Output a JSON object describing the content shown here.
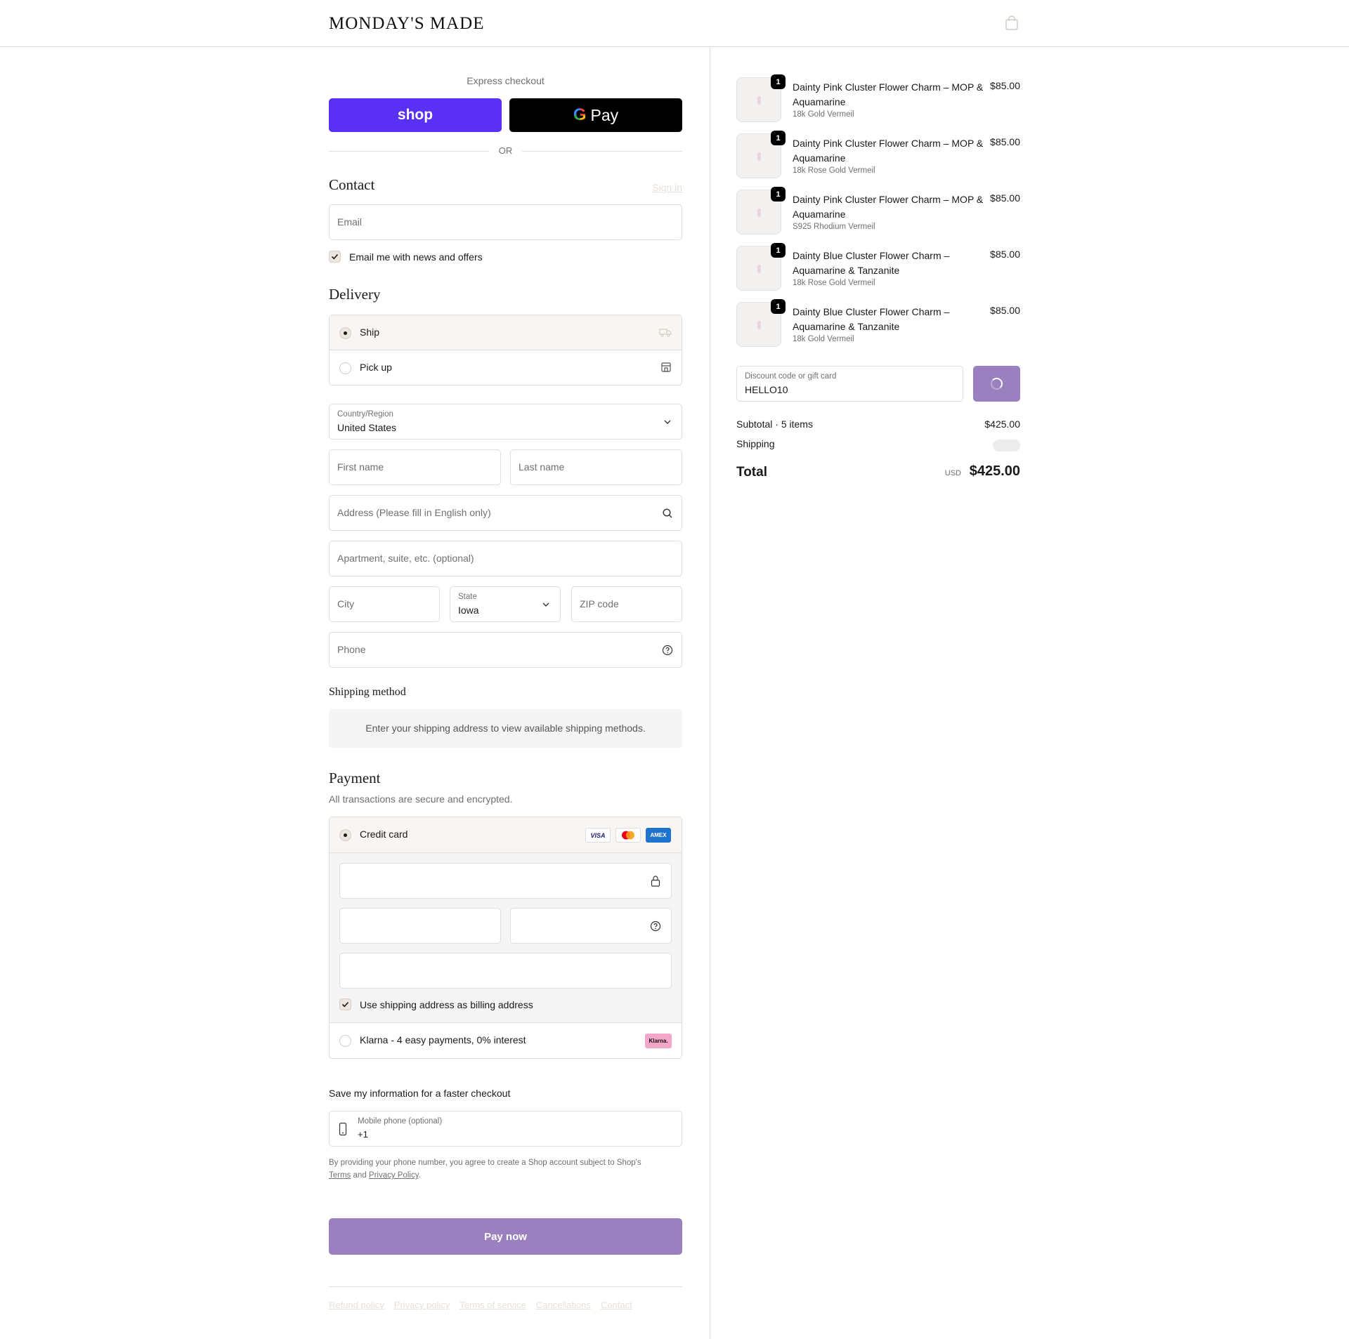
{
  "header": {
    "brand": "MONDAY'S MADE",
    "cart_icon": "shopping-bag-icon"
  },
  "express": {
    "label": "Express checkout",
    "shop_label": "shop",
    "gpay_g": "G",
    "gpay_label": "Pay",
    "or_label": "OR"
  },
  "contact": {
    "title": "Contact",
    "signin_label": "Sign in",
    "email_placeholder": "Email",
    "newsletter_label": "Email me with news and offers",
    "newsletter_checked": true
  },
  "delivery": {
    "title": "Delivery",
    "options": [
      {
        "label": "Ship",
        "icon": "truck-icon",
        "selected": true
      },
      {
        "label": "Pick up",
        "icon": "store-icon",
        "selected": false
      }
    ],
    "country_label": "Country/Region",
    "country_value": "United States",
    "first_name_placeholder": "First name",
    "last_name_placeholder": "Last name",
    "address_placeholder": "Address (Please fill in English only)",
    "apartment_placeholder": "Apartment, suite, etc. (optional)",
    "city_placeholder": "City",
    "state_label": "State",
    "state_value": "Iowa",
    "zip_placeholder": "ZIP code",
    "phone_placeholder": "Phone"
  },
  "shipping_method": {
    "title": "Shipping method",
    "info": "Enter your shipping address to view available shipping methods."
  },
  "payment": {
    "title": "Payment",
    "subtitle": "All transactions are secure and encrypted.",
    "credit_card_label": "Credit card",
    "card_brands": [
      "VISA",
      "MC",
      "AMEX"
    ],
    "billing_same_label": "Use shipping address as billing address",
    "klarna_label": "Klarna - 4 easy payments, 0% interest",
    "klarna_badge": "Klarna."
  },
  "save_info": {
    "title": "Save my information for a faster checkout",
    "mobile_label": "Mobile phone (optional)",
    "mobile_value": "+1",
    "legal_prefix": "By providing your phone number, you agree to create a Shop account subject to Shop's",
    "terms_link": "Terms",
    "and_text": "and",
    "privacy_link": "Privacy Policy",
    "period": "."
  },
  "pay_button": "Pay now",
  "footer_links": [
    "Refund policy",
    "Privacy policy",
    "Terms of service",
    "Cancellations",
    "Contact"
  ],
  "order": {
    "items": [
      {
        "qty": "1",
        "name": "Dainty Pink Cluster Flower Charm – MOP & Aquamarine",
        "variant": "18k Gold Vermeil",
        "price": "$85.00"
      },
      {
        "qty": "1",
        "name": "Dainty Pink Cluster Flower Charm – MOP & Aquamarine",
        "variant": "18k Rose Gold Vermeil",
        "price": "$85.00"
      },
      {
        "qty": "1",
        "name": "Dainty Pink Cluster Flower Charm – MOP & Aquamarine",
        "variant": "S925 Rhodium Vermeil",
        "price": "$85.00"
      },
      {
        "qty": "1",
        "name": "Dainty Blue Cluster Flower Charm – Aquamarine & Tanzanite",
        "variant": "18k Rose Gold Vermeil",
        "price": "$85.00"
      },
      {
        "qty": "1",
        "name": "Dainty Blue Cluster Flower Charm – Aquamarine & Tanzanite",
        "variant": "18k Gold Vermeil",
        "price": "$85.00"
      }
    ],
    "discount_label": "Discount code or gift card",
    "discount_value": "HELLO10",
    "subtotal_label": "Subtotal · 5 items",
    "subtotal_value": "$425.00",
    "shipping_label": "Shipping",
    "total_label": "Total",
    "currency": "USD",
    "total_value": "$425.00"
  },
  "colors": {
    "accent": "#9a80bf",
    "shop_pay": "#5a31f4",
    "border": "#dedede",
    "muted_text": "#707070"
  }
}
